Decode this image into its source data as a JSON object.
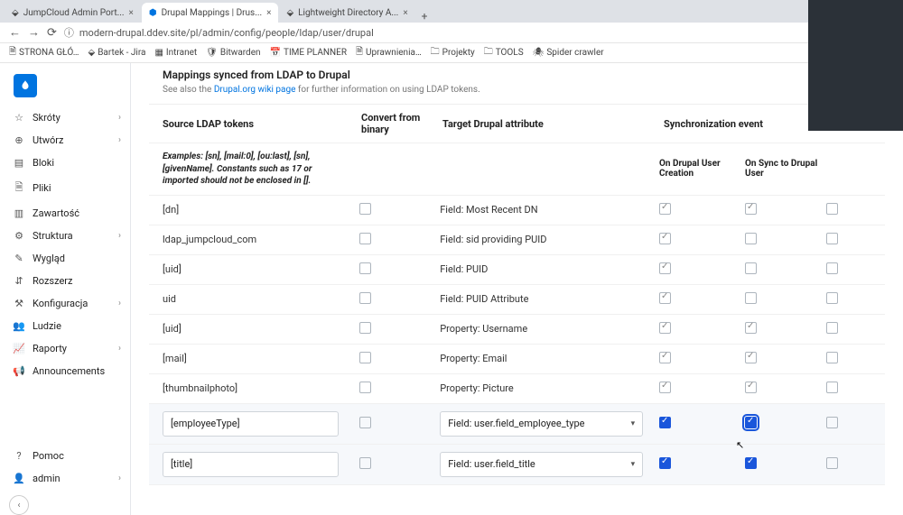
{
  "browser": {
    "tabs": [
      {
        "label": "JumpCloud Admin Port..."
      },
      {
        "label": "Drupal Mappings | Drus..."
      },
      {
        "label": "Lightweight Directory A..."
      }
    ],
    "url": "modern-drupal.ddev.site/pl/admin/config/people/ldap/user/drupal",
    "bookmarks": [
      "STRONA GŁÓ…",
      "Bartek - Jira",
      "Intranet",
      "Bitwarden",
      "TIME PLANNER",
      "Uprawnienia…",
      "Projekty",
      "TOOLS",
      "Spider crawler"
    ]
  },
  "sidebar": {
    "items": [
      {
        "icon": "☆",
        "label": "Skróty",
        "caret": true
      },
      {
        "icon": "⊕",
        "label": "Utwórz",
        "caret": true
      },
      {
        "icon": "▤",
        "label": "Bloki"
      },
      {
        "icon": "🗎",
        "label": "Pliki"
      },
      {
        "icon": "▥",
        "label": "Zawartość"
      },
      {
        "icon": "⚙",
        "label": "Struktura",
        "caret": true
      },
      {
        "icon": "✎",
        "label": "Wygląd"
      },
      {
        "icon": "⇵",
        "label": "Rozszerz"
      },
      {
        "icon": "⚒",
        "label": "Konfiguracja",
        "caret": true
      },
      {
        "icon": "👥",
        "label": "Ludzie"
      },
      {
        "icon": "📈",
        "label": "Raporty",
        "caret": true
      },
      {
        "icon": "📢",
        "label": "Announcements"
      }
    ],
    "bottom": [
      {
        "icon": "?",
        "label": "Pomoc"
      },
      {
        "icon": "👤",
        "label": "admin",
        "caret": true
      }
    ]
  },
  "card": {
    "title": "Mappings synced from LDAP to Drupal",
    "hint_pre": "See also the ",
    "hint_link": "Drupal.org wiki page",
    "hint_post": " for further information on using LDAP tokens."
  },
  "headers": {
    "src": "Source LDAP tokens",
    "bin": "Convert from binary",
    "tgt": "Target Drupal attribute",
    "sync": "Synchronization event",
    "c1": "On Drupal User Creation",
    "c2": "On Sync to Drupal User"
  },
  "examples": "Examples: [sn], [mail:0], [ou:last], [sn], [givenName]. Constants such as <em>17</em> or <em>imported</em> should not be enclosed in [].",
  "rows": [
    {
      "src": "[dn]",
      "tgt": "Field: Most Recent DN",
      "c1": true,
      "c2": true,
      "edit": false
    },
    {
      "src": "ldap_jumpcloud_com",
      "tgt": "Field: sid providing PUID",
      "c1": true,
      "c2": false,
      "edit": false
    },
    {
      "src": "[uid]",
      "tgt": "Field: PUID",
      "c1": true,
      "c2": false,
      "edit": false
    },
    {
      "src": "uid",
      "tgt": "Field: PUID Attribute",
      "c1": true,
      "c2": false,
      "edit": false
    },
    {
      "src": "[uid]",
      "tgt": "Property: Username",
      "c1": true,
      "c2": true,
      "edit": false
    },
    {
      "src": "[mail]",
      "tgt": "Property: Email",
      "c1": true,
      "c2": true,
      "edit": false
    },
    {
      "src": "[thumbnailphoto]",
      "tgt": "Property: Picture",
      "c1": true,
      "c2": true,
      "edit": false
    },
    {
      "src": "[employeeType]",
      "tgt": "Field: user.field_employee_type",
      "c1": true,
      "c2": true,
      "edit": true,
      "focus": true
    },
    {
      "src": "[title]",
      "tgt": "Field: user.field_title",
      "c1": true,
      "c2": true,
      "edit": true
    }
  ]
}
